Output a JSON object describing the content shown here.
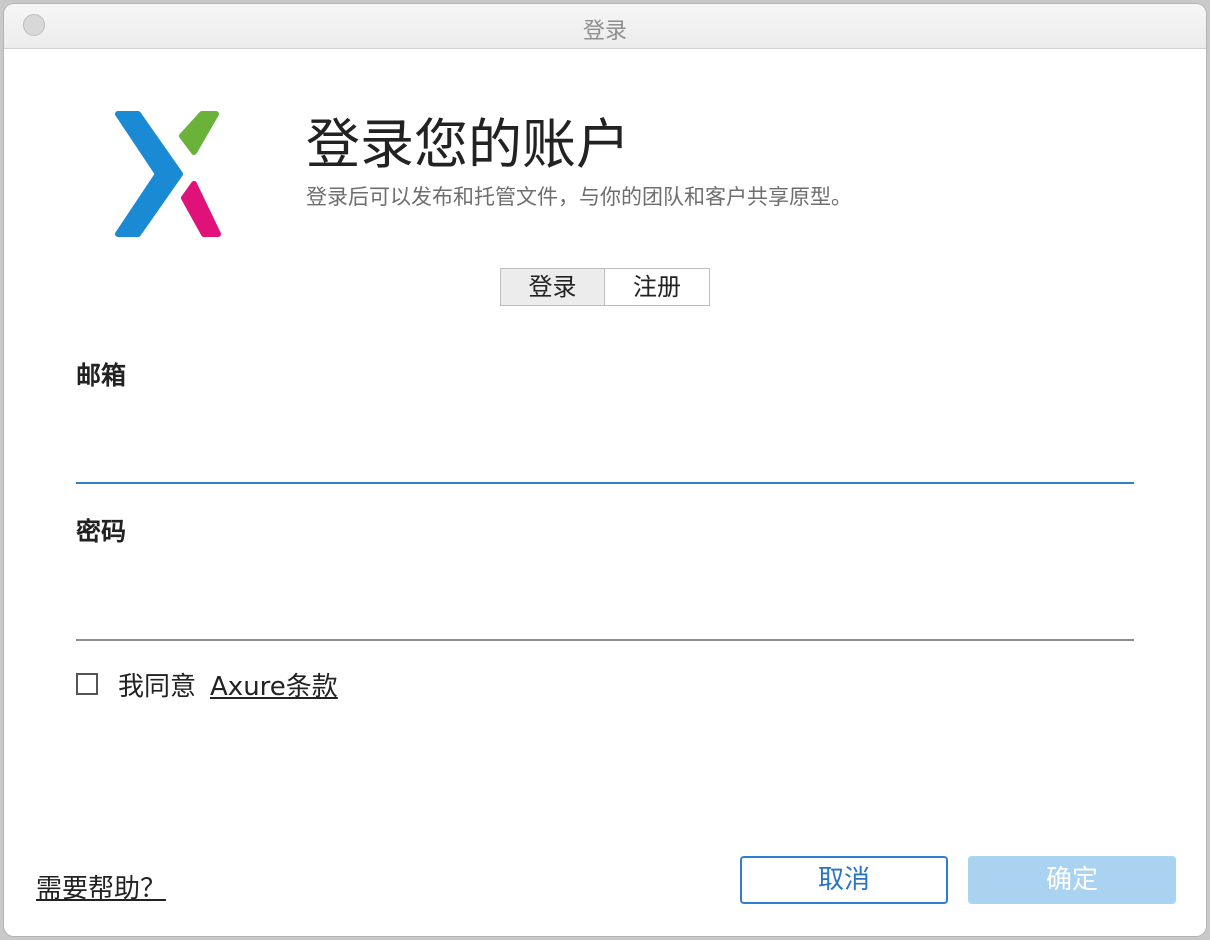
{
  "window": {
    "title": "登录"
  },
  "header": {
    "heading": "登录您的账户",
    "subheading": "登录后可以发布和托管文件，与你的团队和客户共享原型。"
  },
  "tabs": [
    {
      "label": "登录",
      "active": true
    },
    {
      "label": "注册",
      "active": false
    }
  ],
  "form": {
    "email_label": "邮箱",
    "email_value": "",
    "password_label": "密码",
    "password_value": "",
    "agree_text": "我同意",
    "terms_link": "Axure条款",
    "agree_checked": false
  },
  "footer": {
    "help_link": "需要帮助？",
    "cancel_label": "取消",
    "ok_label": "确定"
  },
  "colors": {
    "accent": "#2f7fd0",
    "logo_blue": "#1a8ad4",
    "logo_green": "#6ab23a",
    "logo_pink": "#e0127a",
    "disabled_button": "#a9d3f0"
  },
  "icons": {
    "logo": "axure-logo-icon"
  }
}
